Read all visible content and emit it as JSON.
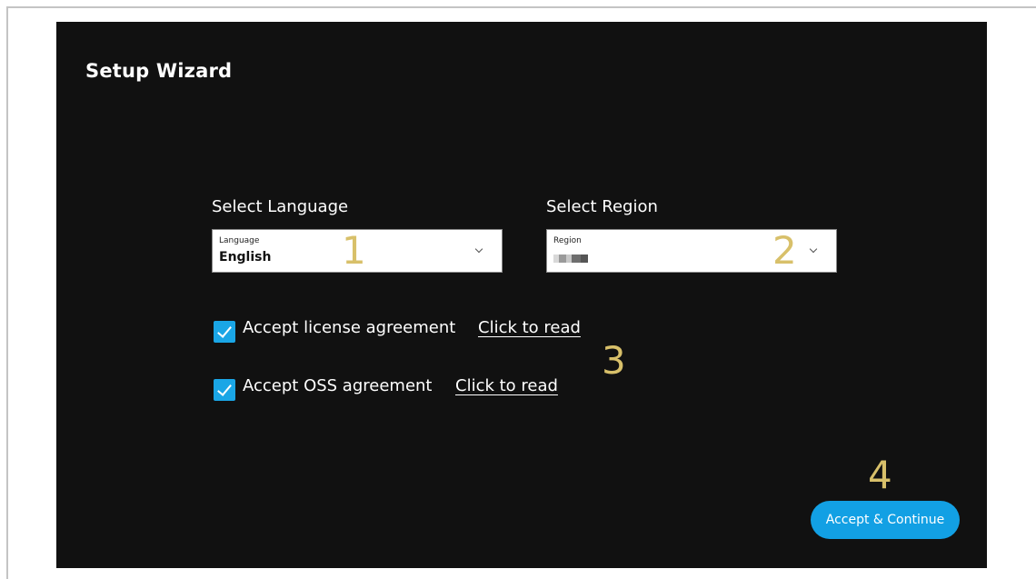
{
  "wizard": {
    "title": "Setup Wizard"
  },
  "language": {
    "section_label": "Select Language",
    "field_label": "Language",
    "value": "English",
    "step_number": "1"
  },
  "region": {
    "section_label": "Select Region",
    "field_label": "Region",
    "step_number": "2"
  },
  "agreements": {
    "step_number": "3",
    "license": {
      "label": "Accept license agreement",
      "link": "Click to read",
      "checked": true
    },
    "oss": {
      "label": "Accept OSS agreement",
      "link": "Click to read",
      "checked": true
    }
  },
  "actions": {
    "step_number": "4",
    "continue_label": "Accept & Continue"
  },
  "icons": {
    "dropdown": "chevron-down-icon",
    "checkbox": "checkmark-icon"
  },
  "colors": {
    "background": "#111111",
    "accent": "#12a0e4",
    "step_number": "#d8c06a",
    "text": "#ffffff"
  }
}
